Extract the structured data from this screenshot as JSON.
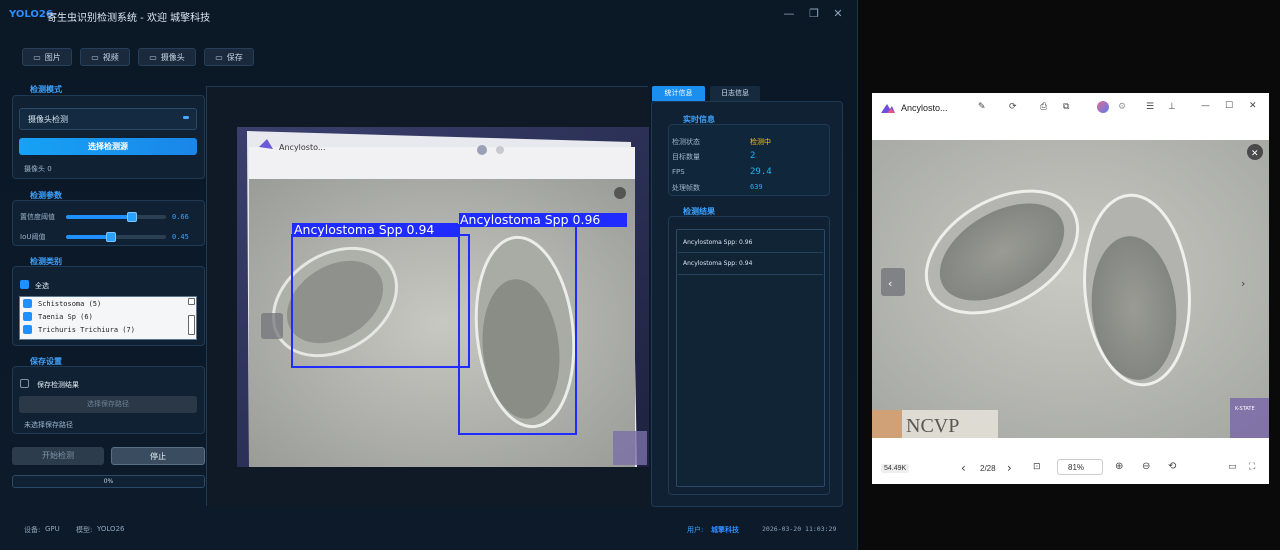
{
  "app": {
    "brand": "YOLO26",
    "title": "寄生虫识别检测系统 - 欢迎 城擎科技",
    "window_controls": [
      "—",
      "❐",
      "✕"
    ],
    "toolbar": [
      {
        "icon": "image-icon",
        "glyph": "▭",
        "label": "图片"
      },
      {
        "icon": "video-icon",
        "glyph": "▭",
        "label": "视频"
      },
      {
        "icon": "camera-icon",
        "glyph": "▭",
        "label": "摄像头"
      },
      {
        "icon": "save-icon",
        "glyph": "▭",
        "label": "保存"
      }
    ],
    "detect_mode": {
      "title": "检测模式",
      "combo_value": "摄像头检测",
      "select_button": "选择检测源",
      "camera_status": "摄像头 0"
    },
    "params": {
      "title": "检测参数",
      "conf_label": "置信度阈值",
      "conf_value": "0.66",
      "conf_level": 0.66,
      "iou_label": "IoU阈值",
      "iou_value": "0.45",
      "iou_level": 0.45
    },
    "classes": {
      "title": "检测类别",
      "select_all": "全选",
      "items": [
        "Schistosoma (5)",
        "Taenia Sp (6)",
        "Trichuris Trichiura (7)"
      ]
    },
    "save": {
      "title": "保存设置",
      "save_checkbox": "保存检测结果",
      "choose_path": "选择保存路径",
      "path_status": "未选择保存路径"
    },
    "actions": {
      "start": "开始检测",
      "stop": "停止",
      "progress": "0%",
      "progress_value": 0
    },
    "tabs": [
      "统计信息",
      "日志信息"
    ],
    "realtime": {
      "title": "实时信息",
      "rows": [
        {
          "key": "检测状态",
          "value": "检测中"
        },
        {
          "key": "目标数量",
          "value": "2"
        },
        {
          "key": "FPS",
          "value": "29.4"
        },
        {
          "key": "处理帧数",
          "value": "639"
        }
      ]
    },
    "results": {
      "title": "检测结果",
      "items": [
        "Ancylostoma Spp: 0.96",
        "Ancylostoma Spp: 0.94"
      ]
    },
    "detections": [
      {
        "label": "Ancylostoma Spp 0.94"
      },
      {
        "label": "Ancylostoma Spp 0.96"
      }
    ],
    "inner_viewer_title": "Ancylosto...",
    "statusbar": {
      "device_label": "设备:",
      "device": "GPU",
      "model_label": "模型:",
      "model": "YOLO26",
      "user_label": "用户:",
      "user": "城擎科技",
      "datetime": "2026-03-20 11:03:29"
    },
    "colors": {
      "accent": "#1e90ff",
      "box": "#1f2bff",
      "bg": "#0b1826"
    }
  },
  "viewer": {
    "title": "Ancylosto...",
    "toolbar_icons": [
      "edit-icon",
      "rotate-icon",
      "print-icon",
      "copy-icon",
      "avatar-icon",
      "settings-icon",
      "menu-icon",
      "pin-icon"
    ],
    "window_controls": [
      "—",
      "☐",
      "✕"
    ],
    "file_size": "54.49K",
    "page": "2/28",
    "zoom": "81%",
    "watermark": "NCVP",
    "logo_text": "K-STATE"
  }
}
